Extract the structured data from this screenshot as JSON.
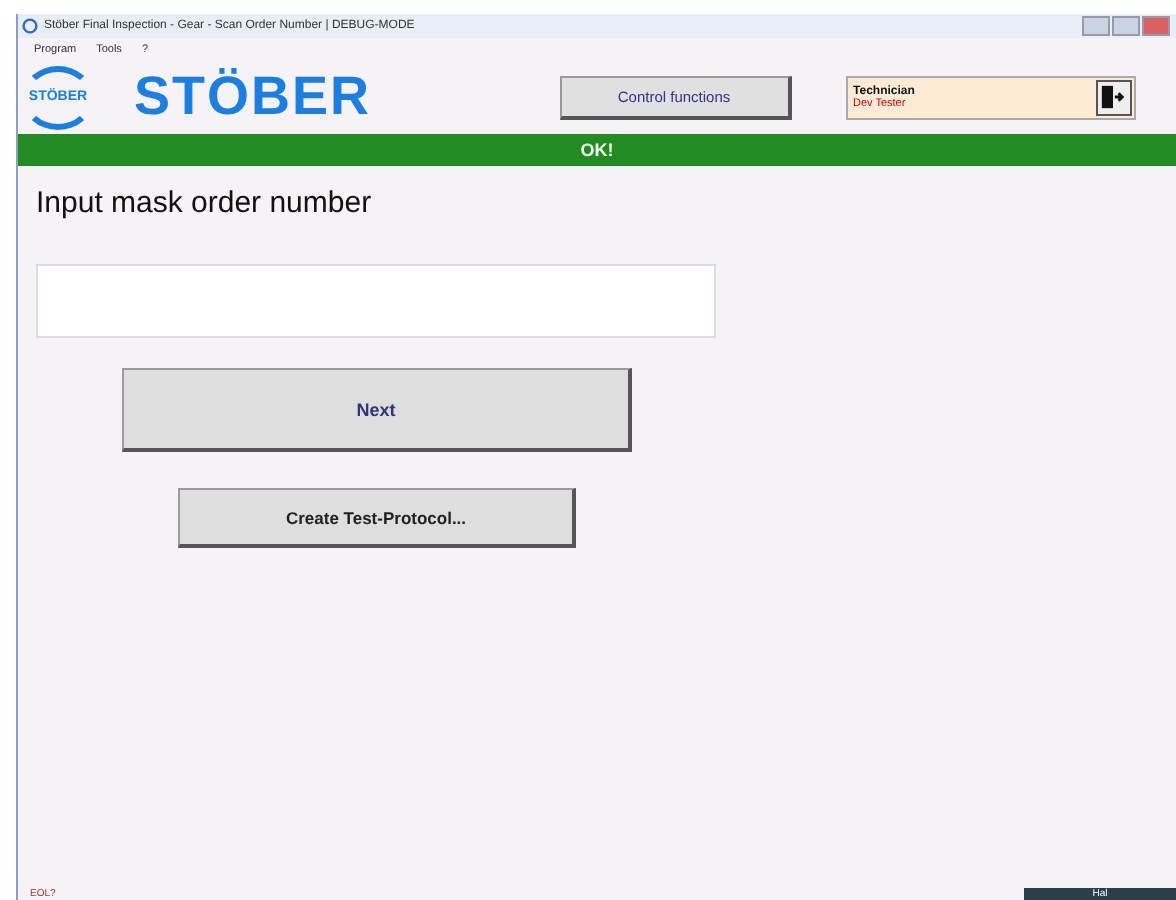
{
  "window": {
    "title": "Stöber Final Inspection - Gear - Scan Order Number | DEBUG-MODE"
  },
  "menu": [
    "Program",
    "Tools",
    "?"
  ],
  "brand": {
    "logo_small": "STÖBER",
    "logo_text": "STÖBER"
  },
  "control_button": "Control functions",
  "user": {
    "role": "Technician",
    "name": "Dev Tester"
  },
  "status": {
    "message": "OK!"
  },
  "heading": "Input mask order number",
  "buttons": [
    {
      "label": "Next",
      "kind": "large"
    },
    {
      "label": "Create Test-Protocol...",
      "kind": "small"
    }
  ],
  "status_bar": {
    "left": "EOL?",
    "right": "Hal"
  }
}
